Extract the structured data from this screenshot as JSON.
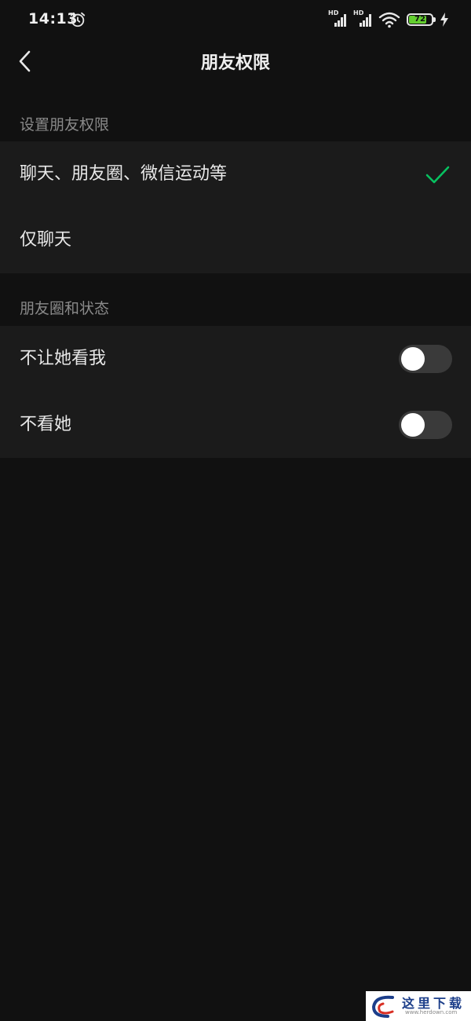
{
  "status": {
    "time": "14:13",
    "signal1_label": "HD",
    "signal2_label": "HD",
    "battery_level": "72",
    "icons": [
      "alarm-icon",
      "signal-icon",
      "signal-icon",
      "wifi-icon",
      "battery-icon",
      "charging-icon"
    ]
  },
  "nav": {
    "title": "朋友权限",
    "back_icon": "chevron-left-icon"
  },
  "sections": {
    "permission_header": "设置朋友权限",
    "moments_header": "朋友圈和状态"
  },
  "permission_options": [
    {
      "label": "聊天、朋友圈、微信运动等",
      "selected": true
    },
    {
      "label": "仅聊天",
      "selected": false
    }
  ],
  "moments_options": [
    {
      "label": "不让她看我",
      "enabled": false
    },
    {
      "label": "不看她",
      "enabled": false
    }
  ],
  "colors": {
    "background": "#111111",
    "group_bg": "#1b1b1b",
    "accent_green": "#07c160",
    "battery_green": "#63cf2f",
    "toggle_off": "#3a3a3a"
  },
  "watermark": {
    "text_cn": "这里下载",
    "text_en": "www.herdown.com"
  }
}
